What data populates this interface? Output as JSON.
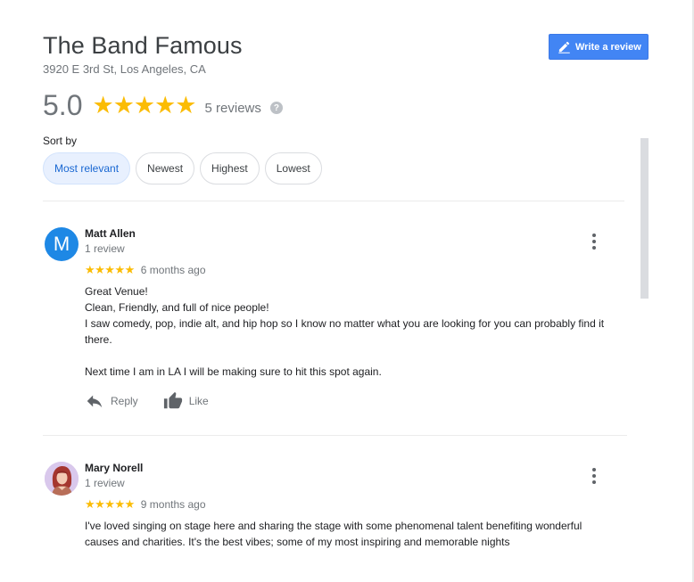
{
  "place": {
    "name": "The Band Famous",
    "address": "3920 E 3rd St, Los Angeles, CA",
    "rating": "5.0",
    "stars": "★★★★★",
    "review_count": "5 reviews",
    "help_symbol": "?"
  },
  "write_review": {
    "label": "Write a review",
    "icon": "pencil-icon"
  },
  "sort": {
    "label": "Sort by",
    "options": [
      "Most relevant",
      "Newest",
      "Highest",
      "Lowest"
    ],
    "selected": "Most relevant"
  },
  "reviews": [
    {
      "avatar_letter": "M",
      "avatar_color": "#1e88e5",
      "name": "Matt Allen",
      "reviewer_info": "1 review",
      "stars": "★★★★★",
      "time_ago": "6 months ago",
      "text": "Great Venue!\nClean, Friendly, and full of nice people!\nI saw comedy, pop, indie alt, and hip hop so I know no matter what you are looking for you can probably find it there.\n\nNext time I am in LA I will be making sure to hit this spot again.",
      "reply_label": "Reply",
      "like_label": "Like"
    },
    {
      "avatar_letter": "",
      "name": "Mary Norell",
      "reviewer_info": "1 review",
      "stars": "★★★★★",
      "time_ago": "9 months ago",
      "text": "I've loved singing on stage here and sharing the stage with some phenomenal talent benefiting wonderful causes and charities. It's the best vibes; some of my most inspiring and memorable nights"
    }
  ],
  "colors": {
    "accent": "#4285f4",
    "star": "#fbbc04",
    "chip_active_bg": "#e8f0fe",
    "chip_active_text": "#1967d2"
  }
}
